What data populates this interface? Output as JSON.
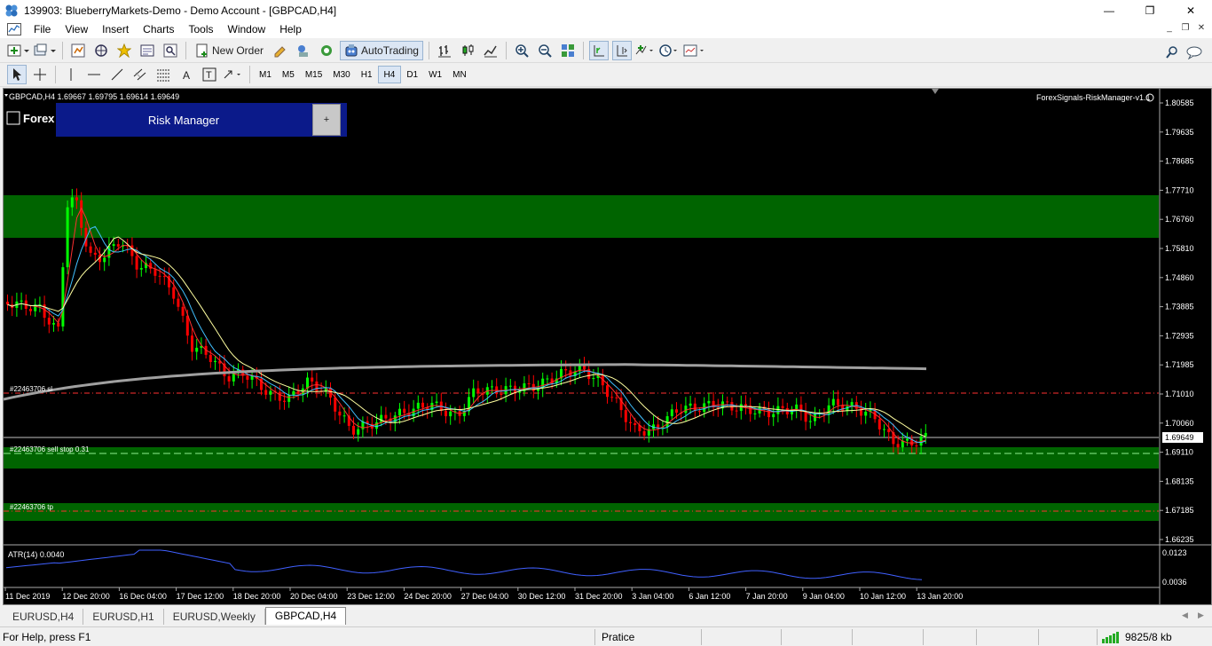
{
  "window": {
    "title": "139903: BlueberryMarkets-Demo - Demo Account - [GBPCAD,H4]",
    "minimize": "—",
    "restore": "❐",
    "close": "✕"
  },
  "menu": [
    "File",
    "View",
    "Insert",
    "Charts",
    "Tools",
    "Window",
    "Help"
  ],
  "toolbar": {
    "new_order": "New Order",
    "autotrading": "AutoTrading",
    "timeframes": [
      "M1",
      "M5",
      "M15",
      "M30",
      "H1",
      "H4",
      "D1",
      "W1",
      "MN"
    ],
    "active_timeframe": "H4"
  },
  "chart": {
    "symbol_info": "GBPCAD,H4  1.69667 1.69795 1.69614 1.69649",
    "ea_label": "ForexSignals-RiskManager-v1.1",
    "logo_text": "Forex",
    "risk_manager": {
      "title": "Risk Manager",
      "plus": "+"
    },
    "order_labels": {
      "sl": "#22463706 sl",
      "sell_stop": "#22463706 sell stop 0.31",
      "tp": "#22463706 tp"
    },
    "current_price": "1.69649",
    "price_axis": [
      "1.80585",
      "1.79635",
      "1.78685",
      "1.77710",
      "1.76760",
      "1.75810",
      "1.74860",
      "1.73885",
      "1.72935",
      "1.71985",
      "1.71010",
      "1.70060",
      "1.69110",
      "1.68135",
      "1.67185",
      "1.66235"
    ],
    "time_axis": [
      "11 Dec 2019",
      "12 Dec 20:00",
      "16 Dec 04:00",
      "17 Dec 12:00",
      "18 Dec 20:00",
      "20 Dec 04:00",
      "23 Dec 12:00",
      "24 Dec 20:00",
      "27 Dec 04:00",
      "30 Dec 12:00",
      "31 Dec 20:00",
      "3 Jan 04:00",
      "6 Jan 12:00",
      "7 Jan 20:00",
      "9 Jan 04:00",
      "10 Jan 12:00",
      "13 Jan 20:00"
    ],
    "atr_label": "ATR(14) 0.0040",
    "atr_axis": [
      "0.0123",
      "0.0036"
    ],
    "colors": {
      "bull": "#00ff00",
      "bear": "#ff0000",
      "zone": "#006400",
      "ma_gray": "#a0a0a0"
    }
  },
  "tabs": [
    {
      "label": "EURUSD,H4",
      "active": false
    },
    {
      "label": "EURUSD,H1",
      "active": false
    },
    {
      "label": "EURUSD,Weekly",
      "active": false
    },
    {
      "label": "GBPCAD,H4",
      "active": true
    }
  ],
  "status": {
    "help": "For Help, press F1",
    "profile": "Pratice",
    "traffic": "9825/8 kb"
  }
}
